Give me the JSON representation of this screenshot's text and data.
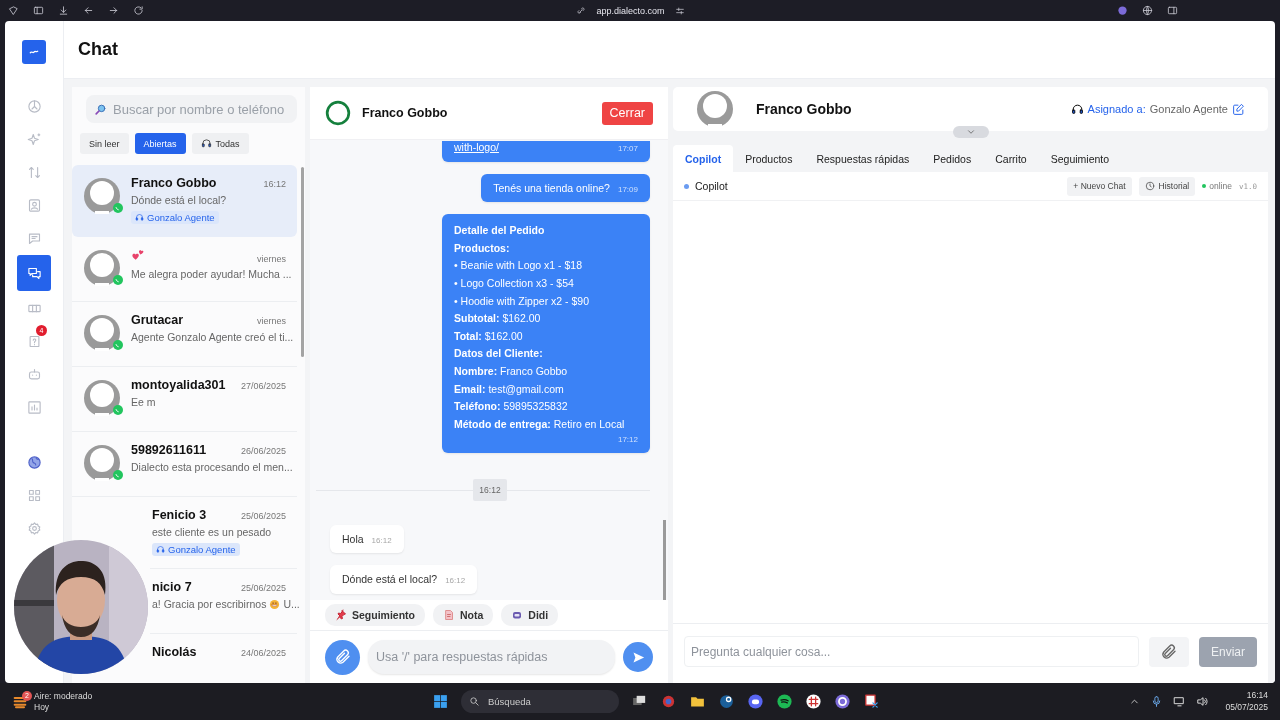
{
  "browser": {
    "url": "app.dialecto.com"
  },
  "sidebar": {
    "items": [
      {
        "selected": false
      },
      {
        "selected": false
      },
      {
        "selected": false
      },
      {
        "selected": false
      },
      {
        "selected": false
      },
      {
        "selected": true
      },
      {
        "selected": false
      },
      {
        "selected": false,
        "badge": "4"
      },
      {
        "selected": false
      },
      {
        "selected": false
      },
      {
        "selected": false
      },
      {
        "selected": false
      },
      {
        "selected": false
      }
    ]
  },
  "header": {
    "title": "Chat"
  },
  "conversation_list": {
    "search": {
      "placeholder": "Buscar por nombre o teléfono"
    },
    "filters": [
      {
        "label": "Sin leer",
        "selected": false
      },
      {
        "label": "Abiertas",
        "selected": true
      },
      {
        "label": "Todas",
        "selected": false
      }
    ],
    "conversations": [
      {
        "name": "Franco Gobbo",
        "time": "16:12",
        "preview": "Dónde está el local?",
        "agent": "Gonzalo Agente",
        "selected": true
      },
      {
        "time": "viernes",
        "preview": "Me alegra poder ayudar! Mucha ...",
        "selected": false
      },
      {
        "name": "Grutacar",
        "time": "viernes",
        "preview": "Agente Gonzalo Agente creó el ti...",
        "selected": false
      },
      {
        "name": "montoyalida301",
        "time": "27/06/2025",
        "preview": "Ee m",
        "selected": false
      },
      {
        "name": "59892611611",
        "time": "26/06/2025",
        "preview": "Dialecto esta procesando el men...",
        "selected": false
      },
      {
        "name": "Fenicio 3",
        "time": "25/06/2025",
        "preview": "este cliente es un pesado",
        "agent": "Gonzalo Agente",
        "selected": false,
        "obscured": true
      },
      {
        "name": "nicio 7",
        "time": "25/06/2025",
        "preview": "a! Gracia por escribirnos",
        "preview_end": "U...",
        "selected": false,
        "obscured": true
      },
      {
        "name": "Nicolás",
        "time": "24/06/2025",
        "selected": false,
        "obscured": true
      }
    ]
  },
  "chat": {
    "contact": "Franco Gobbo",
    "close_button": "Cerrar",
    "messages": [
      {
        "kind": "outgoing",
        "link": "with-logo/",
        "time": "17:07"
      },
      {
        "kind": "outgoing",
        "text": "Tenés una tienda online?",
        "time": "17:09"
      },
      {
        "kind": "outgoing",
        "lines": [
          {
            "kind": "heading",
            "text": "Detalle del Pedido"
          },
          {
            "kind": "heading",
            "text": "Productos:"
          },
          {
            "kind": "item",
            "text": "• Beanie with Logo x1 - $18"
          },
          {
            "kind": "item",
            "text": "• Logo Collection x3 - $54"
          },
          {
            "kind": "item",
            "text": "• Hoodie with Zipper x2 - $90"
          },
          {
            "kind": "field",
            "text": "**Subtotal:** $162.00"
          },
          {
            "kind": "field",
            "text": "**Total:** $162.00"
          },
          {
            "kind": "heading",
            "text": "Datos del Cliente:"
          },
          {
            "kind": "field",
            "text": "**Nombre:** Franco Gobbo"
          },
          {
            "kind": "field",
            "text": "**Email:** test@gmail.com"
          },
          {
            "kind": "field",
            "text": "**Teléfono:** 59895325832"
          },
          {
            "kind": "field",
            "text": "**Método de entrega:** Retiro en Local"
          }
        ],
        "time": "17:12"
      },
      {
        "kind": "divider",
        "time": "16:12"
      },
      {
        "kind": "incoming",
        "text": "Hola",
        "time": "16:12"
      },
      {
        "kind": "incoming",
        "text": "Dónde está el local?",
        "time": "16:12"
      }
    ],
    "quick_actions": [
      {
        "kind": "pin",
        "label": "Seguimiento"
      },
      {
        "kind": "note",
        "label": "Nota"
      },
      {
        "kind": "bot",
        "label": "Didi"
      }
    ],
    "composer": {
      "placeholder": "Usa '/' para respuestas rápidas"
    }
  },
  "details": {
    "contact": "Franco Gobbo",
    "assigned_label": "Asignado a:",
    "assigned_agent": "Gonzalo Agente",
    "tabs": [
      {
        "label": "Copilot",
        "selected": true
      },
      {
        "label": "Productos",
        "selected": false
      },
      {
        "label": "Respuestas rápidas",
        "selected": false
      },
      {
        "label": "Pedidos",
        "selected": false
      },
      {
        "label": "Carrito",
        "selected": false
      },
      {
        "label": "Seguimiento",
        "selected": false
      }
    ],
    "copilot": {
      "title": "Copilot",
      "new_chat": "+ Nuevo Chat",
      "history": "Historial",
      "status": "online",
      "version": "v1.0",
      "input": {
        "placeholder": "Pregunta cualquier cosa..."
      },
      "send_button": "Enviar",
      "send_disabled": true
    }
  },
  "taskbar": {
    "weather": "Aire: moderado",
    "weather_sub": "Hoy",
    "weather_badge": "2",
    "search": "Búsqueda",
    "time": "16:14",
    "date": "05/07/2025"
  }
}
